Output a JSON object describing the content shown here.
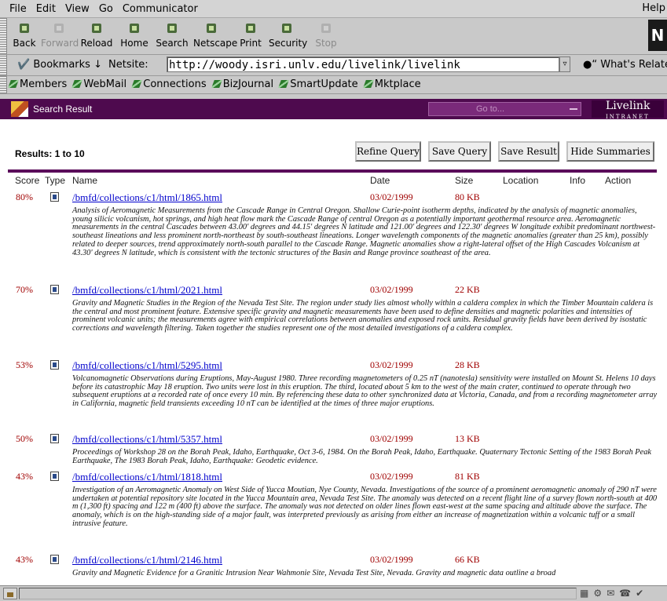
{
  "menu": [
    "File",
    "Edit",
    "View",
    "Go",
    "Communicator"
  ],
  "menu_help": "Help",
  "toolbar": [
    {
      "label": "Back",
      "icon": "back-arrow-icon",
      "disabled": false
    },
    {
      "label": "Forward",
      "icon": "forward-arrow-icon",
      "disabled": true
    },
    {
      "label": "Reload",
      "icon": "reload-icon",
      "disabled": false
    },
    {
      "label": "Home",
      "icon": "home-icon",
      "disabled": false
    },
    {
      "label": "Search",
      "icon": "search-icon",
      "disabled": false
    },
    {
      "label": "Netscape",
      "icon": "netscape-icon",
      "disabled": false
    },
    {
      "label": "Print",
      "icon": "print-icon",
      "disabled": false
    },
    {
      "label": "Security",
      "icon": "security-lock-icon",
      "disabled": false
    },
    {
      "label": "Stop",
      "icon": "stop-icon",
      "disabled": true
    }
  ],
  "location": {
    "bookmarks": "Bookmarks",
    "netsite_label": "Netsite:",
    "url": "http://woody.isri.unlv.edu/livelink/livelink",
    "whats_related": "What's Relate"
  },
  "personal": [
    "Members",
    "WebMail",
    "Connections",
    "BizJournal",
    "SmartUpdate",
    "Mktplace"
  ],
  "header": {
    "title": "Search Result",
    "goto": "Go to...",
    "logo_main": "Livelink",
    "logo_sub": "INTRANET"
  },
  "results_count": "Results: 1 to 10",
  "buttons": {
    "refine": "Refine Query",
    "save_query": "Save Query",
    "save_result": "Save Result",
    "hide": "Hide Summaries"
  },
  "columns": {
    "score": "Score",
    "type": "Type",
    "name": "Name",
    "date": "Date",
    "size": "Size",
    "location": "Location",
    "info": "Info",
    "action": "Action"
  },
  "results": [
    {
      "score": "80%",
      "name": "/bmfd/collections/c1/html/1865.html",
      "date": "03/02/1999",
      "size": "80 KB",
      "summary": "Analysis of Aeromagnetic Measurements from the Cascade Range in Central Oregon. Shallow Curie-point isotherm depths, indicated by the analysis of magnetic anomalies, young silicic volcanism, hot springs, and high heat flow mark the Cascade Range of central Oregon as a potentially important geothermal resource area. Aeromagnetic measurements in the central Cascades between 43.00' degrees and 44.15' degrees N latitude and 121.00' degrees and 122.30' degrees W longitude exhibit predominant northwest-southeast lineations and less prominent north-northeast by south-southeast lineations. Longer wavelength components of the magnetic anomalies (greater than 25 km), possibly related to deeper sources, trend approximately north-south parallel to the Cascade Range. Magnetic anomalies show a right-lateral offset of the High Cascades Volcanism at 43.30' degrees N latitude, which is consistent with the tectonic structures of the Basin and Range province southeast of the area."
    },
    {
      "score": "70%",
      "name": "/bmfd/collections/c1/html/2021.html",
      "date": "03/02/1999",
      "size": "22 KB",
      "summary": "Gravity and Magnetic Studies in the Region of the Nevada Test Site. The region under study lies almost wholly within a caldera complex in which the Timber Mountain caldera is the central and most prominent feature. Extensive specific gravity and magnetic measurements have been used to define densities and magnetic polarities and intensities of prominent volcanic units; the measurements agree with empirical correlations between anomalies and exposed rock units. Residual gravity fields have been derived by isostatic corrections and wavelength filtering. Taken together the studies represent one of the most detailed investigations of a caldera complex."
    },
    {
      "score": "53%",
      "name": "/bmfd/collections/c1/html/5295.html",
      "date": "03/02/1999",
      "size": "28 KB",
      "summary": "Volcanomagnetic Observations during Eruptions, May-August 1980. Three recording magnetometers of 0.25 nT (nanotesla) sensitivity were installed on Mount St. Helens 10 days before its catastrophic May 18 eruption. Two units were lost in this eruption. The third, located about 5 km to the west of the main crater, continued to operate through two subsequent eruptions at a recorded rate of once every 10 min. By referencing these data to other synchronized data at Victoria, Canada, and from a recording magnetometer array in California, magnetic field transients exceeding 10 nT can be identified at the times of three major eruptions."
    },
    {
      "score": "50%",
      "name": "/bmfd/collections/c1/html/5357.html",
      "date": "03/02/1999",
      "size": "13 KB",
      "summary": "Proceedings of Workshop 28 on the Borah Peak, Idaho, Earthquake, Oct 3-6, 1984. On the Borah Peak, Idaho, Earthquake. Quaternary Tectonic Setting of the 1983 Borah Peak Earthquake, The 1983 Borah Peak, Idaho, Earthquake: Geodetic evidence."
    },
    {
      "score": "43%",
      "name": "/bmfd/collections/c1/html/1818.html",
      "date": "03/02/1999",
      "size": "81 KB",
      "summary": "Investigation of an Aeromagnetic Anomaly on West Side of Yucca Moutian, Nye County, Nevada. Investigations of the source of a prominent aeromagnetic anomaly of 290 nT were undertaken at potential repository site located in the Yucca Mountain area, Nevada Test Site. The anomaly was detected on a recent flight line of a survey flown north-south at 400 m (1,300 ft) spacing and 122 m (400 ft) above the surface. The anomaly was not detected on older lines flown east-west at the same spacing and altitude above the surface. The anomaly, which is on the high-standing side of a major fault, was interpreted previously as arising from either an increase of magnetization within a volcanic tuff or a small intrusive feature."
    },
    {
      "score": "43%",
      "name": "/bmfd/collections/c1/html/2146.html",
      "date": "03/02/1999",
      "size": "66 KB",
      "summary": "Gravity and Magnetic Evidence for a Granitic Intrusion Near Wahmonie Site, Nevada Test Site, Nevada. Gravity and magnetic data outline a broad"
    }
  ]
}
